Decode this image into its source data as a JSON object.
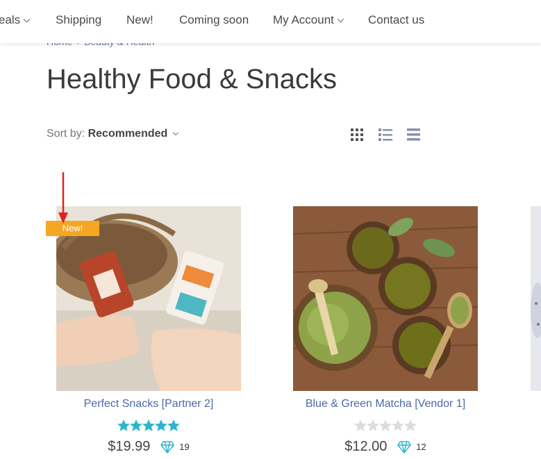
{
  "nav": {
    "items": [
      {
        "label": "eals"
      },
      {
        "label": "Shipping"
      },
      {
        "label": "New!"
      },
      {
        "label": "Coming soon"
      },
      {
        "label": "My Account"
      },
      {
        "label": "Contact us"
      }
    ]
  },
  "breadcrumb": {
    "home": "Home",
    "category": "Beauty & Health"
  },
  "page": {
    "title": "Healthy Food & Snacks"
  },
  "sort": {
    "label": "Sort by:",
    "value": "Recommended"
  },
  "products": [
    {
      "name": "Perfect Snacks [Partner 2]",
      "price": "$19.99",
      "points": "19",
      "rating": 5,
      "badge": "New!"
    },
    {
      "name": "Blue & Green Matcha [Vendor 1]",
      "price": "$12.00",
      "points": "12",
      "rating": 0
    }
  ],
  "colors": {
    "accent_link": "#4d67a6",
    "star_filled": "#2bb5cf",
    "star_empty": "#dcdcdc",
    "badge": "#f5a623",
    "arrow": "#e3211b"
  }
}
